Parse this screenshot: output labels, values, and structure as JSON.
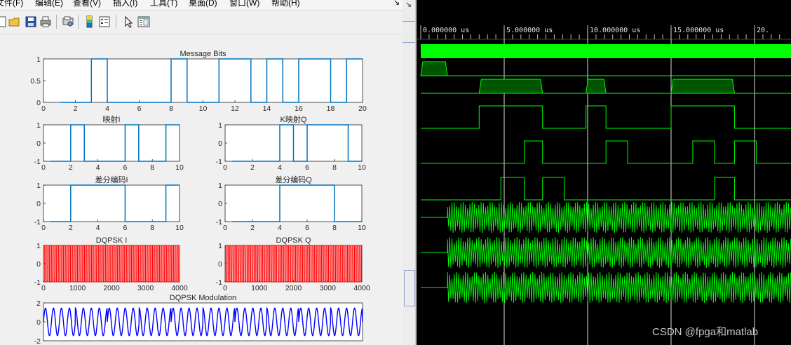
{
  "menu": {
    "items": [
      "文件(F)",
      "编辑(E)",
      "查看(V)",
      "插入(I)",
      "工具(T)",
      "桌面(D)",
      "窗口(W)",
      "帮助(H)"
    ],
    "pin_glyph": "↘"
  },
  "toolbar": {
    "icons": [
      "new-figure-icon",
      "open-folder-icon",
      "save-icon",
      "print-icon",
      "print-preview-icon",
      "colorbar-icon",
      "legend-icon",
      "pointer-icon",
      "property-editor-icon"
    ]
  },
  "colors": {
    "matlab_plot": "#0072bd",
    "matlab_red": "#ff0000",
    "modulation_blue": "#0000ff",
    "wave_green": "#00ff00",
    "wave_dark_fill": "#005500",
    "cursor_line": "#dcdcdc"
  },
  "chart_data": [
    {
      "type": "line",
      "step": true,
      "title": "Message Bits",
      "xlim": [
        0,
        20
      ],
      "ylim": [
        0,
        1
      ],
      "xticks": [
        0,
        2,
        4,
        6,
        8,
        10,
        12,
        14,
        16,
        18,
        20
      ],
      "yticks": [
        0,
        0.5,
        1
      ],
      "x": [
        1,
        3,
        3,
        4,
        4,
        8,
        8,
        9,
        9,
        11,
        11,
        13,
        13,
        14,
        14,
        15,
        15,
        16,
        16,
        18,
        18,
        19,
        19,
        20
      ],
      "y": [
        0,
        0,
        1,
        1,
        0,
        0,
        1,
        1,
        0,
        0,
        1,
        1,
        0,
        0,
        1,
        1,
        0,
        0,
        1,
        1,
        0,
        0,
        1,
        1
      ]
    },
    {
      "type": "line",
      "step": true,
      "title": "映射I",
      "xlim": [
        0,
        10
      ],
      "ylim": [
        -1,
        1
      ],
      "xticks": [
        0,
        2,
        4,
        6,
        8,
        10
      ],
      "yticks": [
        -1,
        0,
        1
      ],
      "x": [
        0.5,
        2,
        2,
        3,
        3,
        6,
        6,
        7,
        7,
        9,
        9,
        10
      ],
      "y": [
        -1,
        -1,
        1,
        1,
        -1,
        -1,
        1,
        1,
        -1,
        -1,
        1,
        1
      ]
    },
    {
      "type": "line",
      "step": true,
      "title": "K映射Q",
      "xlim": [
        0,
        10
      ],
      "ylim": [
        -1,
        1
      ],
      "xticks": [
        0,
        2,
        4,
        6,
        8,
        10
      ],
      "yticks": [
        -1,
        0,
        1
      ],
      "x": [
        0.5,
        4,
        4,
        5,
        5,
        6,
        6,
        9,
        9,
        10
      ],
      "y": [
        -1,
        -1,
        1,
        1,
        -1,
        -1,
        1,
        1,
        -1,
        -1
      ]
    },
    {
      "type": "line",
      "step": true,
      "title": "差分编码I",
      "xlim": [
        0,
        10
      ],
      "ylim": [
        -1,
        1
      ],
      "xticks": [
        0,
        2,
        4,
        6,
        8,
        10
      ],
      "yticks": [
        -1,
        0,
        1
      ],
      "x": [
        0.5,
        2,
        2,
        6,
        6,
        9,
        9,
        10
      ],
      "y": [
        -1,
        -1,
        1,
        1,
        -1,
        -1,
        1,
        1
      ]
    },
    {
      "type": "line",
      "step": true,
      "title": "差分编码Q",
      "xlim": [
        0,
        10
      ],
      "ylim": [
        -1,
        1
      ],
      "xticks": [
        0,
        2,
        4,
        6,
        8,
        10
      ],
      "yticks": [
        -1,
        0,
        1
      ],
      "x": [
        0.5,
        4,
        4,
        6,
        6,
        7,
        7,
        8,
        8,
        10
      ],
      "y": [
        -1,
        -1,
        1,
        1,
        1,
        1,
        1,
        1,
        -1,
        -1
      ]
    },
    {
      "type": "line",
      "title": "DQPSK I",
      "xlim": [
        0,
        4000
      ],
      "ylim": [
        -1,
        1
      ],
      "xticks": [
        0,
        1000,
        2000,
        3000,
        4000
      ],
      "yticks": [
        -1,
        0,
        1
      ],
      "cycles": 58
    },
    {
      "type": "line",
      "title": "DQPSK Q",
      "xlim": [
        0,
        4000
      ],
      "ylim": [
        -1,
        1
      ],
      "xticks": [
        0,
        1000,
        2000,
        3000,
        4000
      ],
      "yticks": [
        -1,
        0,
        1
      ],
      "cycles": 58
    },
    {
      "type": "line",
      "title": "DQPSK Modulation",
      "xlim": [
        0,
        4000
      ],
      "ylim": [
        -2,
        2
      ],
      "xticks": [],
      "yticks": [
        -2,
        0,
        2
      ],
      "cycles": 40
    }
  ],
  "wave": {
    "time_labels": [
      "0.000000 us",
      "5.000000 us",
      "10.000000 us",
      "15.000000 us",
      "20."
    ],
    "time_max_us": 21.5,
    "cursors_us": [
      5,
      10,
      15,
      20
    ],
    "tracks": [
      {
        "type": "solid"
      },
      {
        "type": "bus",
        "segments": [
          [
            0,
            1.6
          ]
        ]
      },
      {
        "type": "bus",
        "segments": [
          [
            3.5,
            7.3
          ],
          [
            9.9,
            11.1
          ],
          [
            15.0,
            18.8
          ]
        ]
      },
      {
        "type": "digital",
        "edges": [
          3.5,
          7.3,
          9.9,
          11.1,
          15.0,
          18.8
        ],
        "init": 0
      },
      {
        "type": "digital",
        "edges": [
          6.2,
          7.3,
          11.1,
          12.4,
          16.3,
          17.6,
          18.8,
          20.1
        ],
        "init": 0
      },
      {
        "type": "digital",
        "edges": [
          4.8,
          6.2,
          7.3,
          8.6,
          17.6,
          18.8
        ],
        "init": 0
      },
      {
        "type": "analog",
        "start_us": 1.6
      },
      {
        "type": "analog",
        "start_us": 1.6
      },
      {
        "type": "analog",
        "start_us": 1.6
      }
    ]
  },
  "watermark": "CSDN @fpga和matlab"
}
